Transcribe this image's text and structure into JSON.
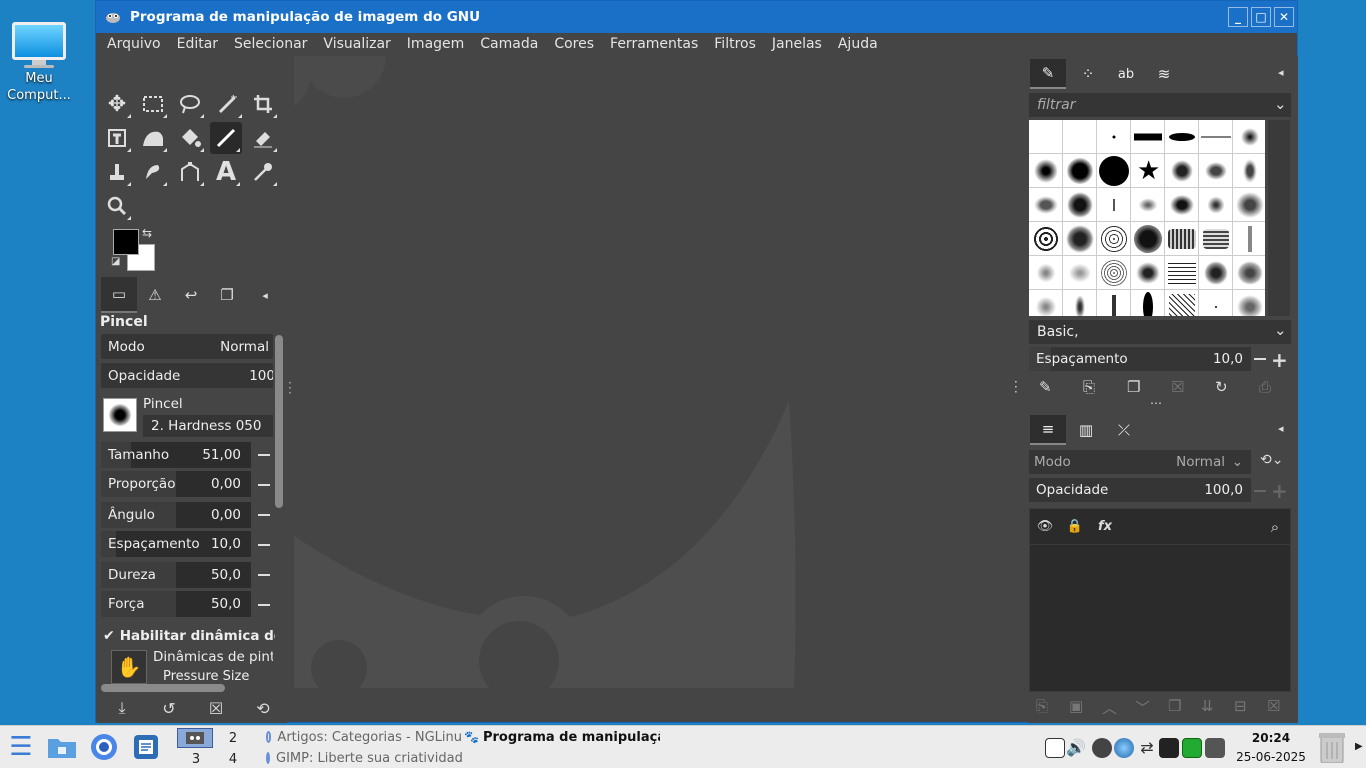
{
  "desktop": {
    "icon_label": "Meu Comput..."
  },
  "window": {
    "title": "Programa de manipulação de imagem do GNU",
    "minimize": "_",
    "maximize": "□",
    "close": "✕"
  },
  "menu": [
    "Arquivo",
    "Editar",
    "Selecionar",
    "Visualizar",
    "Imagem",
    "Camada",
    "Cores",
    "Ferramentas",
    "Filtros",
    "Janelas",
    "Ajuda"
  ],
  "tool_options": {
    "title": "Pincel",
    "mode_label": "Modo",
    "mode_value": "Normal",
    "opacity_label": "Opacidade",
    "opacity_value": "100",
    "brush_label": "Pincel",
    "brush_value": "2. Hardness 050",
    "size_label": "Tamanho",
    "size_value": "51,00",
    "size_fill": 0.2,
    "ratio_label": "Proporção",
    "ratio_value": "0,00",
    "ratio_fill": 0.5,
    "angle_label": "Ângulo",
    "angle_value": "0,00",
    "angle_fill": 0.5,
    "spacing_label": "Espaçamento",
    "spacing_value": "10,0",
    "spacing_fill": 0.1,
    "hardness_label": "Dureza",
    "hardness_value": "50,0",
    "hardness_fill": 0.5,
    "force_label": "Força",
    "force_value": "50,0",
    "force_fill": 0.5,
    "dynamics_check": "Habilitar dinâmica de p",
    "dynamics_label": "Dinâmicas de pintur",
    "dynamics_value": "Pressure Size"
  },
  "brushes": {
    "filter_placeholder": "filtrar",
    "set": "Basic,",
    "spacing_label": "Espaçamento",
    "spacing_value": "10,0"
  },
  "layers": {
    "mode_label": "Modo",
    "mode_value": "Normal",
    "opacity_label": "Opacidade",
    "opacity_value": "100,0"
  },
  "taskbar": {
    "workspaces": [
      "2",
      "3",
      "4"
    ],
    "task1": "Artigos: Categorias - NGLinu",
    "task2": "GIMP: Liberte sua criatividad",
    "task3": "Programa de manipulação",
    "time": "20:24",
    "date": "25-06-2025"
  }
}
